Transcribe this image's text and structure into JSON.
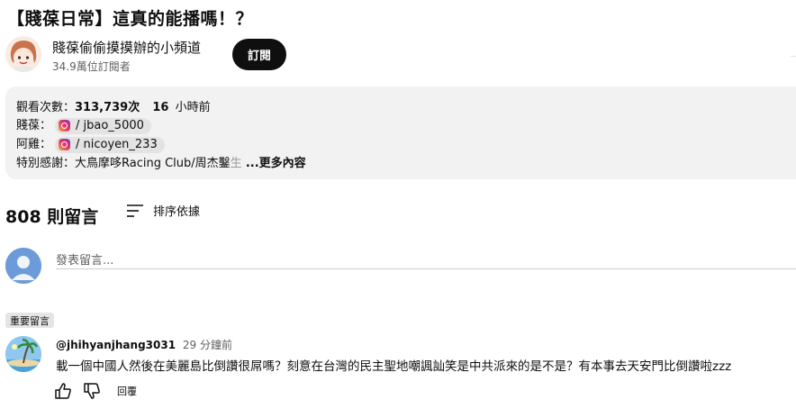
{
  "video": {
    "title": "【賤葆日常】這真的能播嗎！？"
  },
  "channel": {
    "name": "賤葆偷偷摸摸辦的小頻道",
    "subscribers": "34.9萬位訂閱者",
    "subscribe_label": "訂閱"
  },
  "description": {
    "views_label": "觀看次數：",
    "views": "313,739次",
    "age_num": "16",
    "age_unit": "小時前",
    "line1_prefix": "賤葆：",
    "line1_handle": "/ jbao_5000",
    "line2_prefix": "阿雞：",
    "line2_handle": "/ nicoyen_233",
    "line3": "特別感謝：大鳥摩哆Racing Club/周杰鑿",
    "line3_fade": "生",
    "more": "...更多內容"
  },
  "comments": {
    "count_label": "808 則留言",
    "sort_label": "排序依據",
    "input_placeholder": "發表留言...",
    "pinned_badge": "重要留言",
    "items": [
      {
        "user": "@jhihyanjhang3031",
        "time": "29 分鐘前",
        "text": "載一個中國人然後在美麗島比倒讚很屌嗎？刻意在台灣的民主聖地嘲諷訕笑是中共派來的是不是？有本事去天安門比倒讚啦zzz",
        "reply_label": "回覆"
      }
    ]
  },
  "icons": {
    "instagram": "instagram-icon",
    "sort": "sort-icon",
    "like": "thumbs-up-icon",
    "dislike": "thumbs-down-icon"
  },
  "colors": {
    "subscribe_bg": "#0f0f0f",
    "description_bg": "#f2f2f2",
    "avatar_default": "#6b9bd8"
  }
}
